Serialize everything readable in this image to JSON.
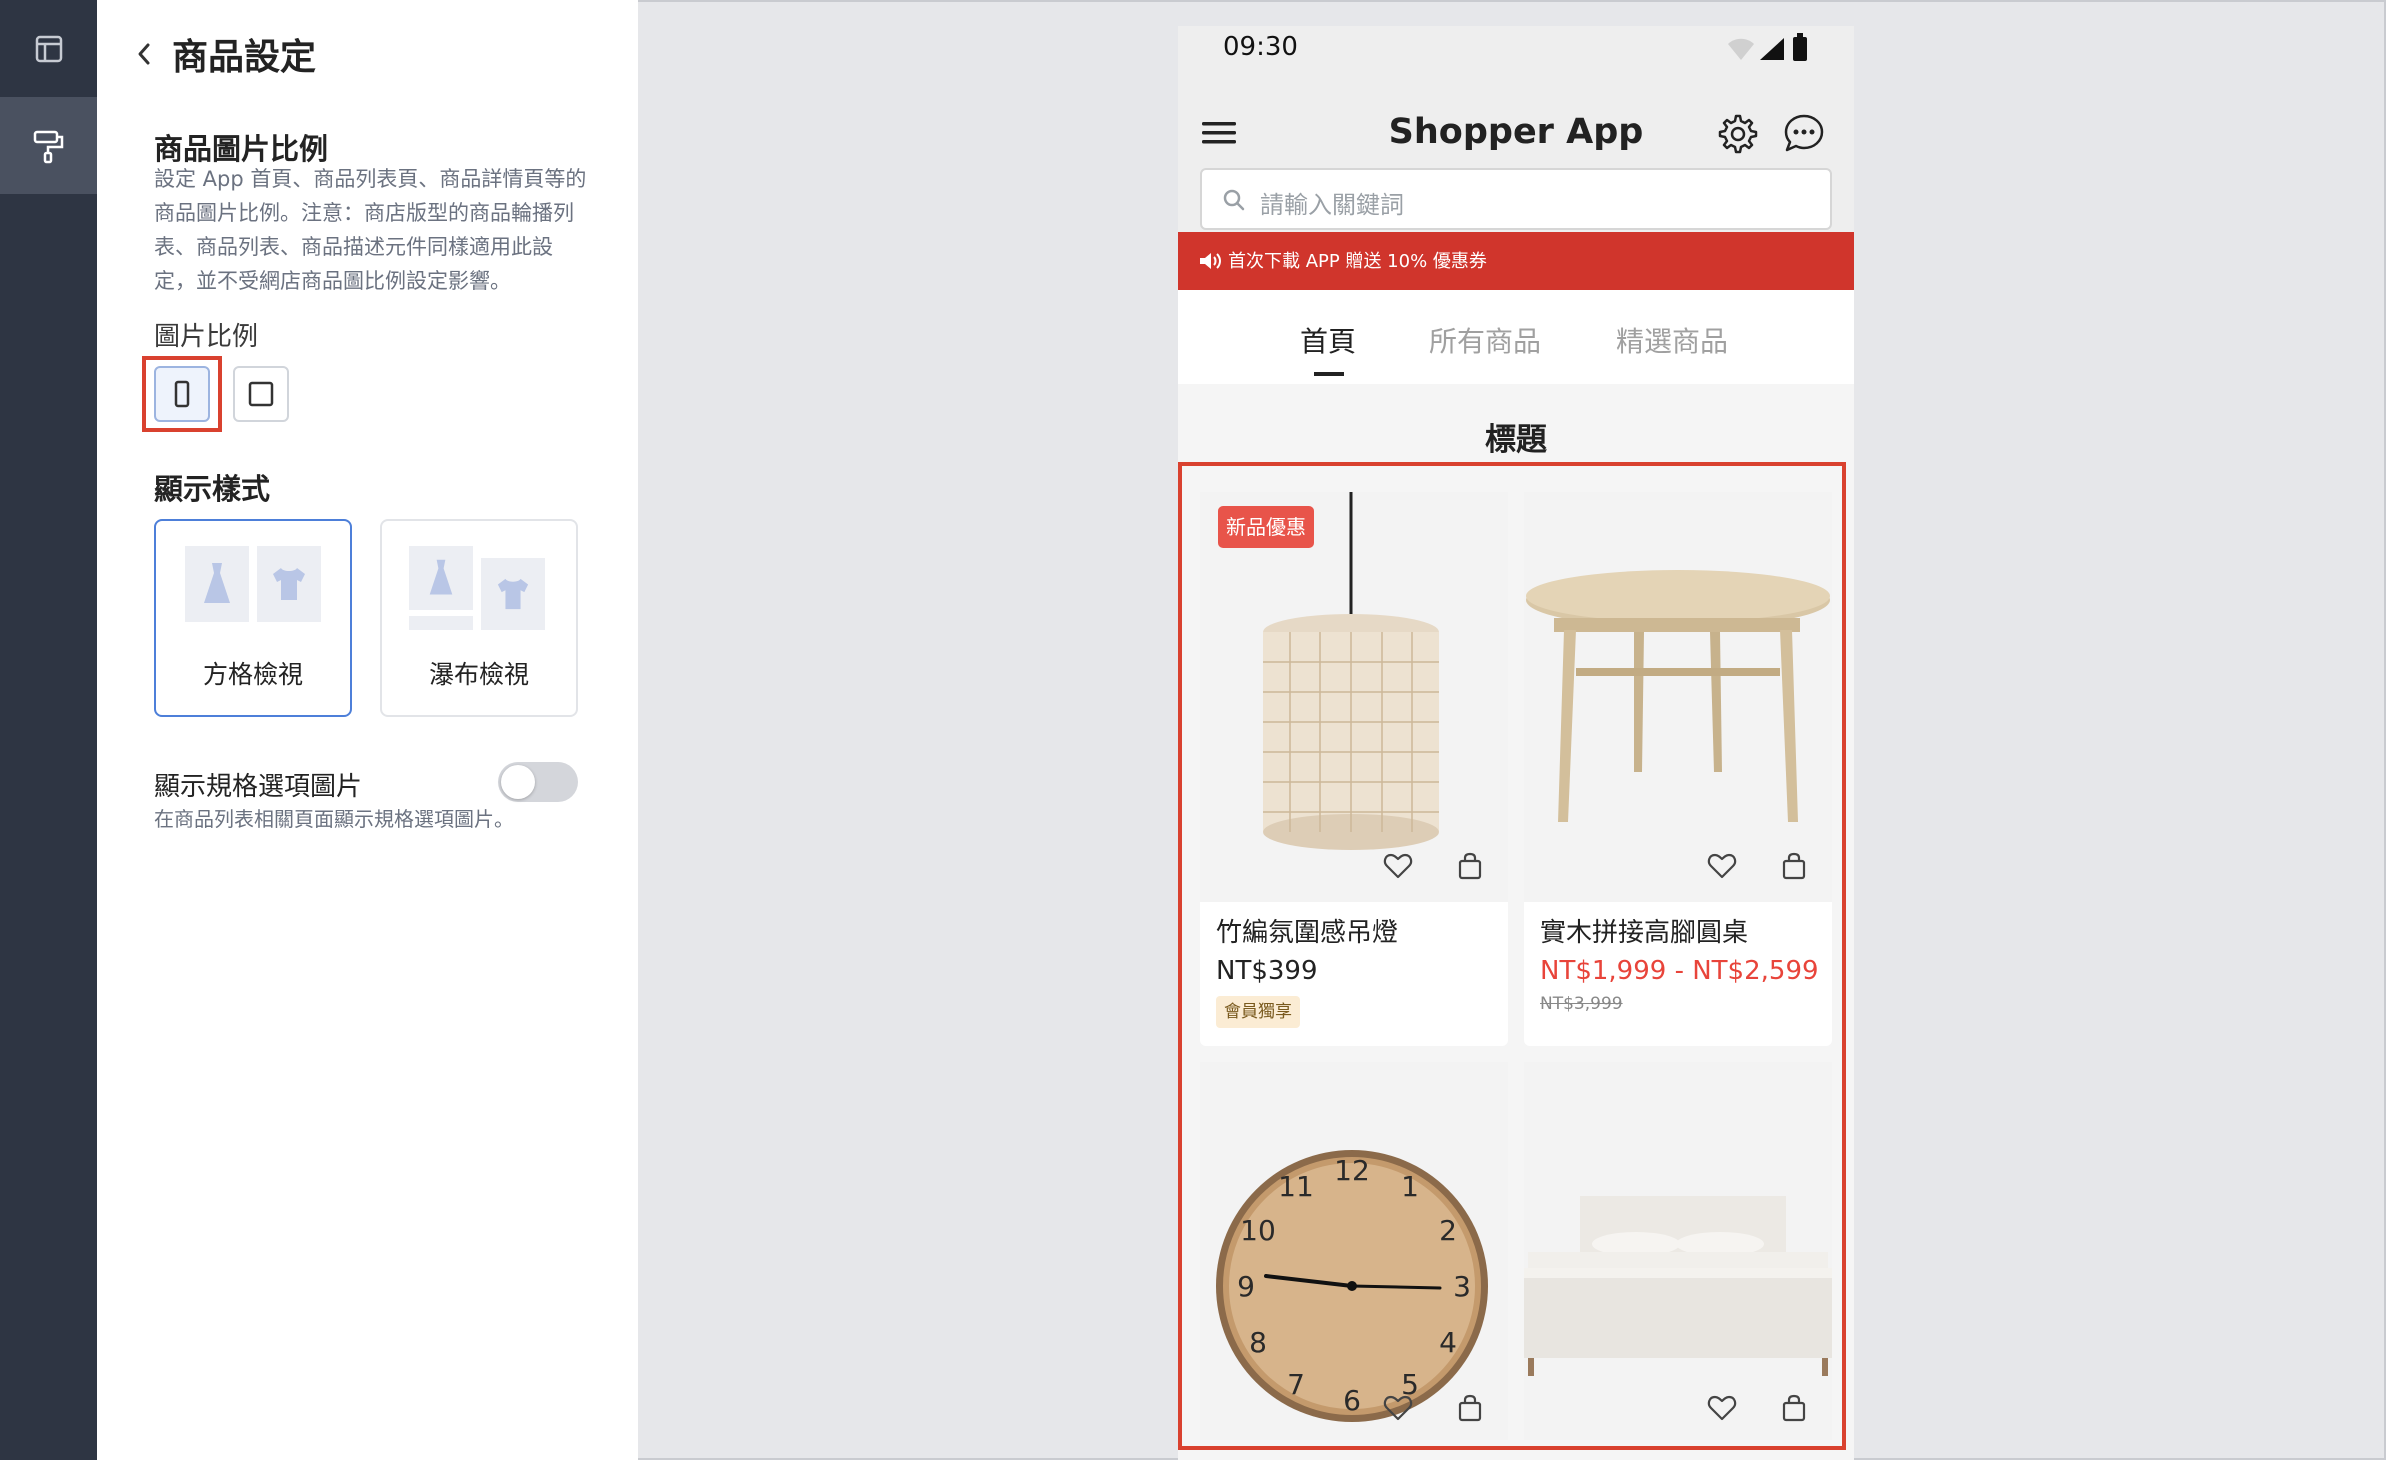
{
  "panel": {
    "title": "商品設定",
    "image_ratio_section": {
      "title": "商品圖片比例",
      "description": "設定 App 首頁、商品列表頁、商品詳情頁等的商品圖片比例。注意：商店版型的商品輪播列表、商品列表、商品描述元件同樣適用此設定，並不受網店商品圖比例設定影響。",
      "ratio_label": "圖片比例",
      "options": [
        "portrait",
        "square"
      ],
      "selected": "portrait"
    },
    "display_style_section": {
      "title": "顯示樣式",
      "options": [
        {
          "label": "方格檢視",
          "selected": true
        },
        {
          "label": "瀑布檢視",
          "selected": false
        }
      ]
    },
    "variant_image": {
      "label": "顯示規格選項圖片",
      "description": "在商品列表相關頁面顯示規格選項圖片。",
      "enabled": false
    }
  },
  "phone": {
    "time": "09:30",
    "app_title": "Shopper App",
    "search_placeholder": "請輸入關鍵詞",
    "banner": "首次下載 APP 贈送 10% 優惠券",
    "tabs": [
      {
        "label": "首頁",
        "active": true
      },
      {
        "label": "所有商品",
        "active": false
      },
      {
        "label": "精選商品",
        "active": false
      }
    ],
    "section_title": "標題",
    "products": [
      {
        "name": "竹編氛圍感吊燈",
        "price": "NT$399",
        "badge": "新品優惠",
        "member_tag": "會員獨享"
      },
      {
        "name": "實木拼接高腳圓桌",
        "price": "NT$1,999 - NT$2,599",
        "original_price": "NT$3,999"
      },
      {
        "name": "",
        "image": "wall-clock"
      },
      {
        "name": "",
        "image": "bed"
      }
    ]
  },
  "colors": {
    "accent_red": "#d0352c",
    "sale_red": "#e8443a",
    "highlight_outline": "#d9412f",
    "selected_blue": "#4d7fd9",
    "rail_dark": "#2e3543"
  }
}
